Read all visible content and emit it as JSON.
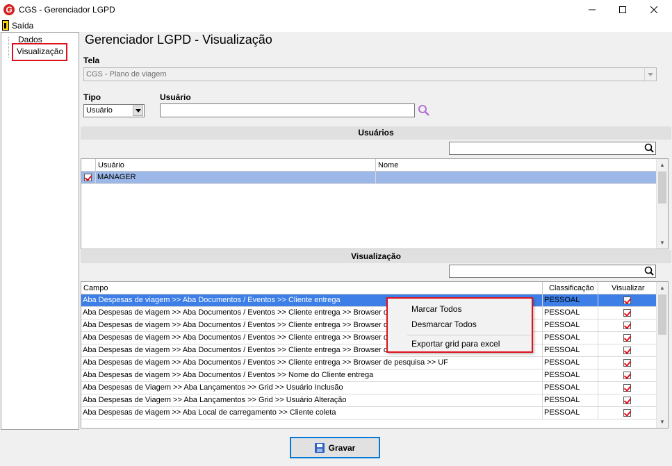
{
  "window": {
    "title": "CGS - Gerenciador LGPD",
    "icon_letter": "G"
  },
  "menu": {
    "saida": "Saída"
  },
  "sidebar": {
    "items": [
      {
        "label": "Dados"
      },
      {
        "label": "Visualização"
      }
    ]
  },
  "main": {
    "title": "Gerenciador LGPD - Visualização",
    "tela_label": "Tela",
    "tela_value": "CGS - Plano de viagem",
    "tipo_label": "Tipo",
    "tipo_value": "Usuário",
    "usuario_label": "Usuário",
    "usuario_value": ""
  },
  "usuarios": {
    "section_title": "Usuários",
    "columns": [
      "Usuário",
      "Nome"
    ],
    "rows": [
      {
        "usuario": "MANAGER",
        "nome": "",
        "checked": true
      }
    ]
  },
  "visualizacao": {
    "section_title": "Visualização",
    "columns": [
      "Campo",
      "Classificação",
      "Visualizar"
    ],
    "rows": [
      {
        "campo": "Aba Despesas de viagem >> Aba Documentos  / Eventos >> Cliente entrega",
        "classificacao": "PESSOAL",
        "visualizar": true
      },
      {
        "campo": "Aba Despesas de viagem >> Aba Documentos  / Eventos >> Cliente entrega >> Browser de",
        "classificacao": "PESSOAL",
        "visualizar": true
      },
      {
        "campo": "Aba Despesas de viagem >> Aba Documentos  / Eventos >> Cliente entrega >> Browser de",
        "classificacao": "PESSOAL",
        "visualizar": true
      },
      {
        "campo": "Aba Despesas de viagem >> Aba Documentos  / Eventos >> Cliente entrega >> Browser de",
        "classificacao": "PESSOAL",
        "visualizar": true
      },
      {
        "campo": "Aba Despesas de viagem >> Aba Documentos  / Eventos >> Cliente entrega >> Browser de",
        "classificacao": "PESSOAL",
        "visualizar": true
      },
      {
        "campo": "Aba Despesas de viagem >> Aba Documentos  / Eventos >> Cliente entrega >> Browser de pesquisa >> UF",
        "classificacao": "PESSOAL",
        "visualizar": true
      },
      {
        "campo": "Aba Despesas de viagem >> Aba Documentos  / Eventos >> Nome do Cliente entrega",
        "classificacao": "PESSOAL",
        "visualizar": true
      },
      {
        "campo": "Aba Despesas de Viagem >> Aba Lançamentos >>  Grid >> Usuário Inclusão",
        "classificacao": "PESSOAL",
        "visualizar": true
      },
      {
        "campo": "Aba Despesas de Viagem >> Aba Lançamentos >> Grid >> Usuário Alteração",
        "classificacao": "PESSOAL",
        "visualizar": true
      },
      {
        "campo": "Aba Despesas de viagem >> Aba Local de carregamento >> Cliente coleta",
        "classificacao": "PESSOAL",
        "visualizar": true
      }
    ]
  },
  "context_menu": {
    "items": [
      "Marcar Todos",
      "Desmarcar Todos",
      "Exportar grid para excel"
    ]
  },
  "footer": {
    "save_label": "Gravar"
  }
}
